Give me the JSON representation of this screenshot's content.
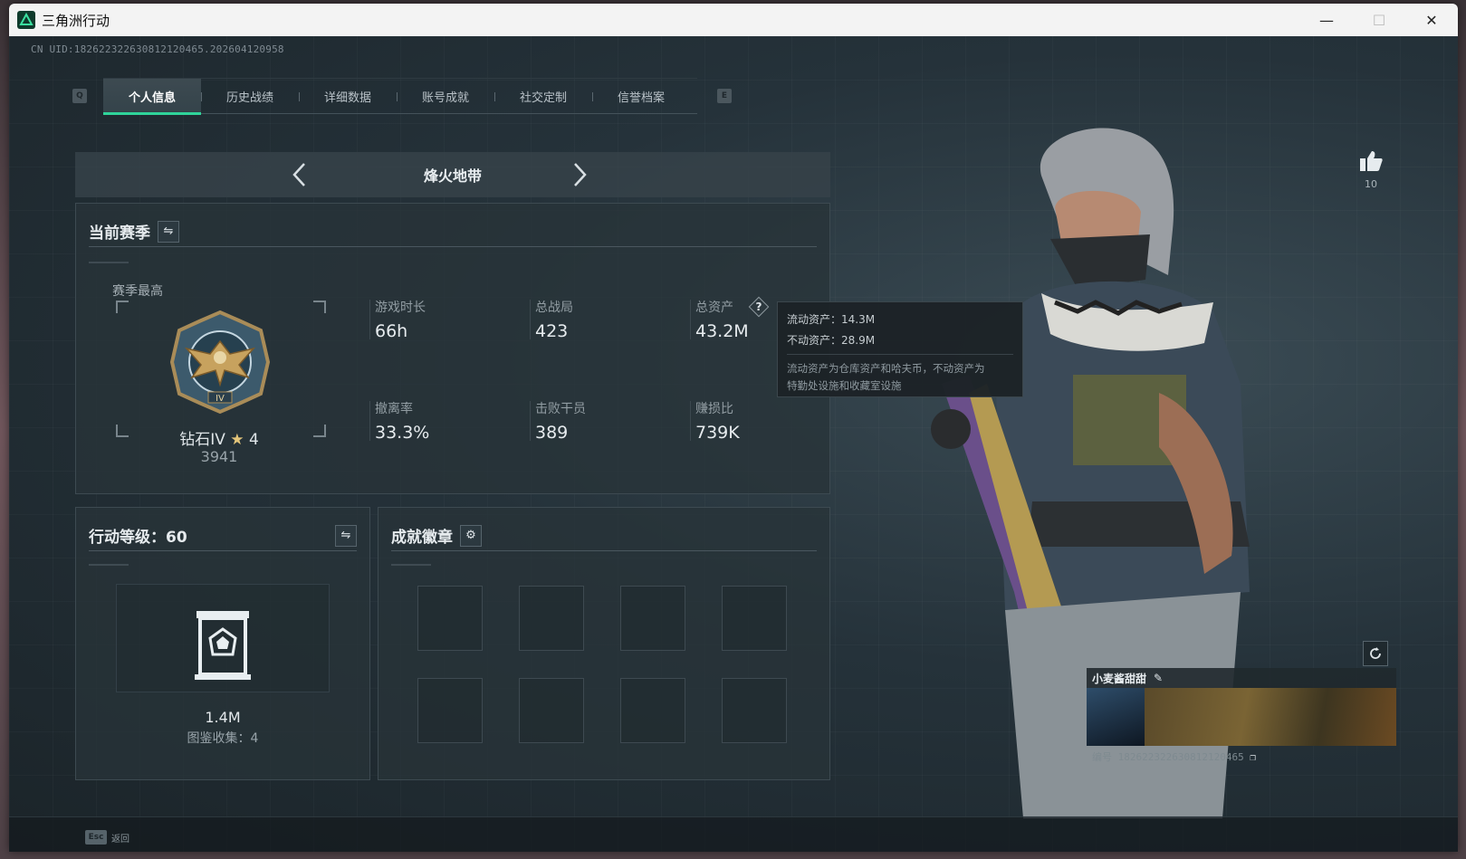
{
  "window": {
    "title": "三角洲行动",
    "minimize": "—",
    "maximize": "☐",
    "close": "✕"
  },
  "uid": "CN UID:182622322630812120465.202604120958",
  "tabs": {
    "key_left": "Q",
    "key_right": "E",
    "items": [
      {
        "label": "个人信息",
        "active": true
      },
      {
        "label": "历史战绩"
      },
      {
        "label": "详细数据"
      },
      {
        "label": "账号成就"
      },
      {
        "label": "社交定制"
      },
      {
        "label": "信誉档案"
      }
    ]
  },
  "mode": {
    "title": "烽火地带"
  },
  "season": {
    "title": "当前赛季",
    "best_label": "赛季最高",
    "rank_name": "钻石IV",
    "rank_stars": "4",
    "rank_score": "3941",
    "stats": [
      {
        "label": "游戏时长",
        "value": "66h"
      },
      {
        "label": "总战局",
        "value": "423"
      },
      {
        "label": "总资产",
        "value": "43.2M"
      },
      {
        "label": "撤离率",
        "value": "33.3%"
      },
      {
        "label": "击败干员",
        "value": "389"
      },
      {
        "label": "赚损比",
        "value": "739K"
      }
    ]
  },
  "tooltip": {
    "liquid": "流动资产：14.3M",
    "fixed": "不动资产：28.9M",
    "note_line1": "流动资产为仓库资产和哈夫币，不动资产为",
    "note_line2": "特勤处设施和收藏室设施"
  },
  "level": {
    "title": "行动等级：60",
    "value": "1.4M",
    "collect": "图鉴收集：4"
  },
  "badges": {
    "title": "成就徽章"
  },
  "likes": {
    "count": "10"
  },
  "player": {
    "name": "小麦酱甜甜",
    "id": "编号 182622322630812120465"
  },
  "footer": {
    "key": "Esc",
    "label": "返回"
  },
  "colors": {
    "accent": "#2fd49a",
    "panel": "#283339",
    "background": "#1c2328"
  }
}
